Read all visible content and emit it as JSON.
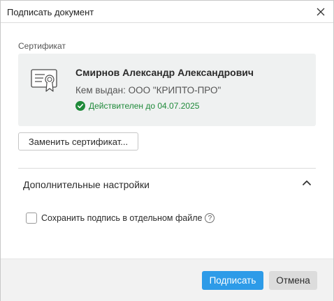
{
  "dialog": {
    "title": "Подписать документ",
    "close_icon": "close-icon"
  },
  "certificate": {
    "section_label": "Сертификат",
    "icon": "certificate-icon",
    "owner": "Смирнов Александр Александрович",
    "issuer": "Кем выдан: ООО \"КРИПТО-ПРО\"",
    "status": "Действителен до 04.07.2025",
    "status_icon": "check-circle-icon",
    "status_color": "#1f8a3a",
    "replace_button": "Заменить сертификат..."
  },
  "advanced": {
    "title": "Дополнительные настройки",
    "expanded": true,
    "toggle_icon": "chevron-up-icon",
    "save_separate": {
      "label": "Сохранить подпись в отдельном файле",
      "checked": false,
      "help_icon": "help-circle-icon",
      "help_glyph": "?"
    }
  },
  "footer": {
    "sign_button": "Подписать",
    "cancel_button": "Отмена",
    "accent_color": "#2d9be8"
  }
}
